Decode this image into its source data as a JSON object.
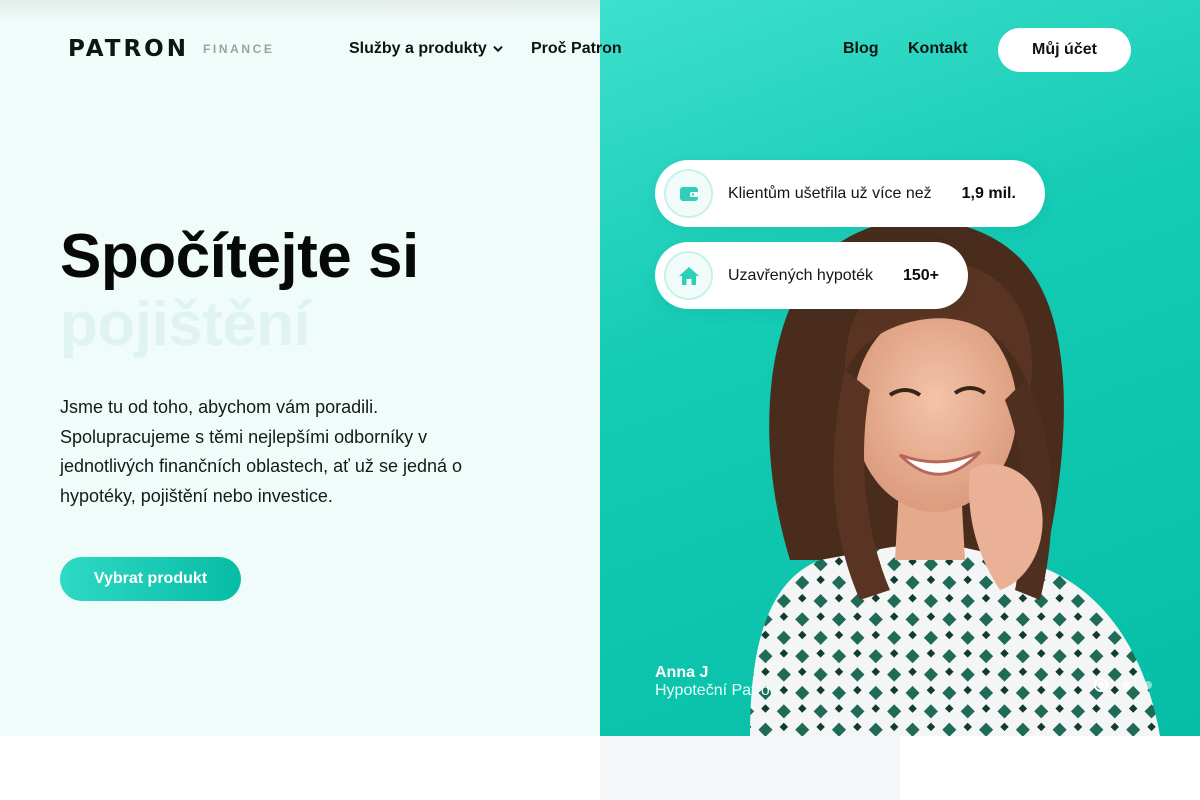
{
  "brand": {
    "logo_word": "PATRON",
    "logo_sub": "FINANCE"
  },
  "nav": {
    "services": "Služby a produkty",
    "services_icon": "chevron-down-icon",
    "why": "Proč Patron",
    "blog": "Blog",
    "contact": "Kontakt",
    "account": "Můj účet"
  },
  "hero": {
    "headline": "Spočítejte si",
    "headline_rotating": "pojištění",
    "lead": "Jsme tu od toho, abychom vám poradili. Spolupracujeme s těmi nejlepšími odborníky v jednotlivých finančních oblastech, ať už se jedná o hypotéky, pojištění nebo investice.",
    "cta": "Vybrat produkt"
  },
  "stats": [
    {
      "icon": "wallet-icon",
      "label": "Klientům ušetřila už více než",
      "value": "1,9 mil."
    },
    {
      "icon": "house-icon",
      "label": "Uzavřených hypoték",
      "value": "150+"
    }
  ],
  "testimonial": {
    "name": "Anna J",
    "role": "Hypoteční Patron"
  },
  "carousel": {
    "active_index": 0,
    "count": 3
  },
  "colors": {
    "accent": "#14cbb4",
    "accent_dark": "#06bea6",
    "hero_left_bg": "#effcf9",
    "text": "#0b0d0c"
  }
}
